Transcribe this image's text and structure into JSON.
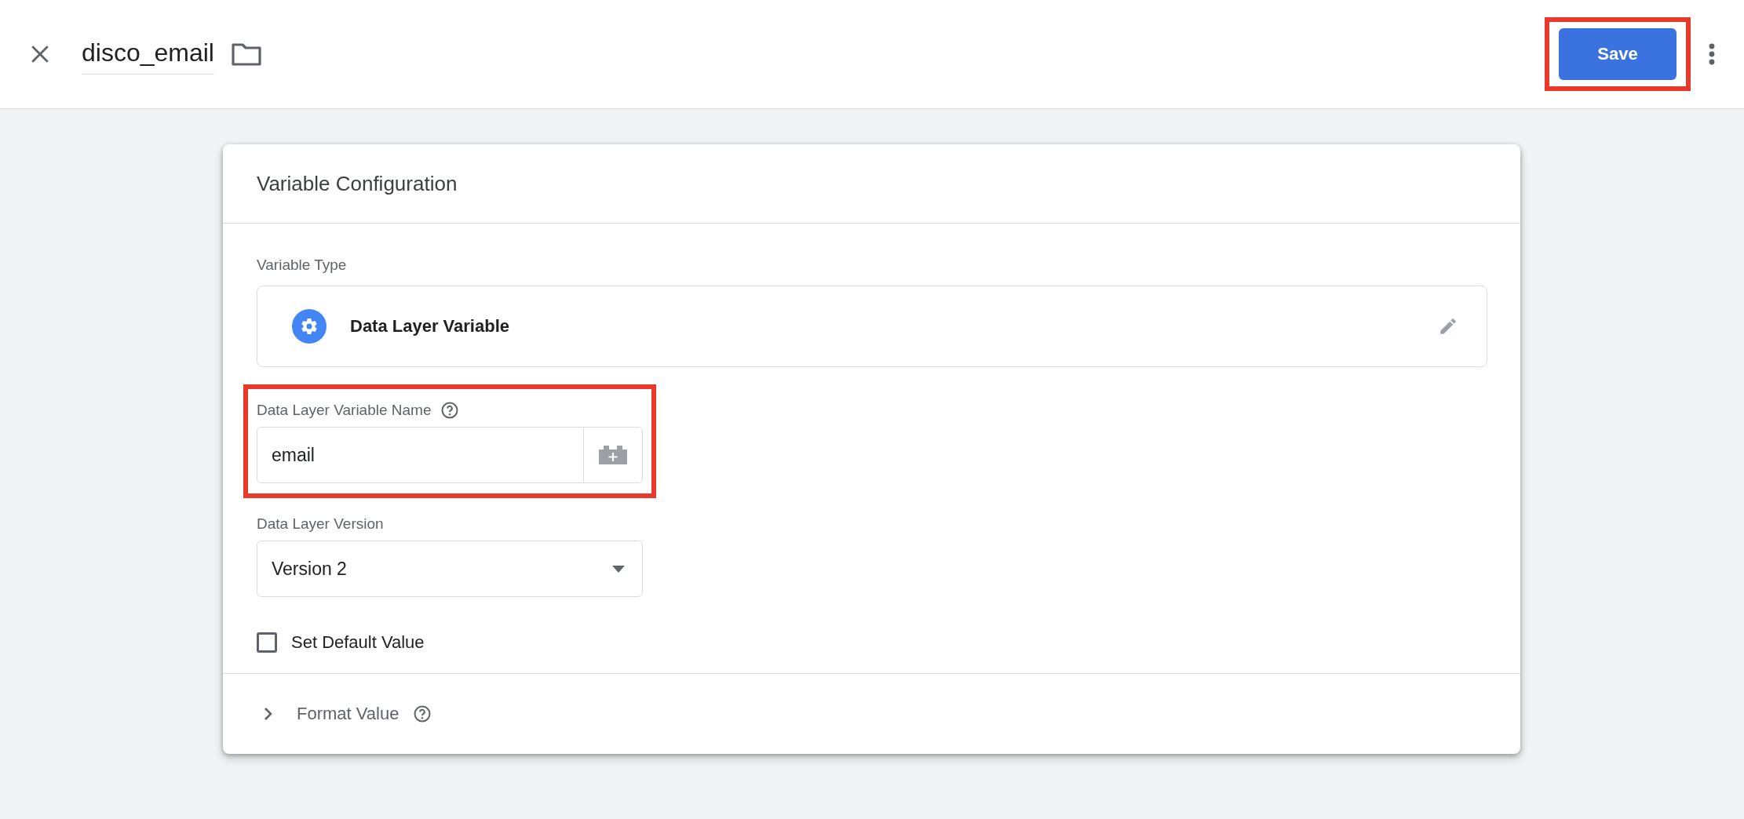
{
  "header": {
    "title": "disco_email",
    "save_button": "Save",
    "save_highlighted": true
  },
  "card": {
    "title": "Variable Configuration",
    "variable_type": {
      "label": "Variable Type",
      "value": "Data Layer Variable"
    },
    "fields": [
      {
        "kind": "text",
        "label": "Data Layer Variable Name",
        "value": "email",
        "help": true,
        "highlighted": true
      },
      {
        "kind": "select",
        "label": "Data Layer Version",
        "value": "Version 2"
      },
      {
        "kind": "checkbox",
        "label": "Set Default Value",
        "checked": false
      }
    ],
    "sections": [
      {
        "label": "Format Value",
        "expanded": false,
        "help": true
      }
    ]
  }
}
